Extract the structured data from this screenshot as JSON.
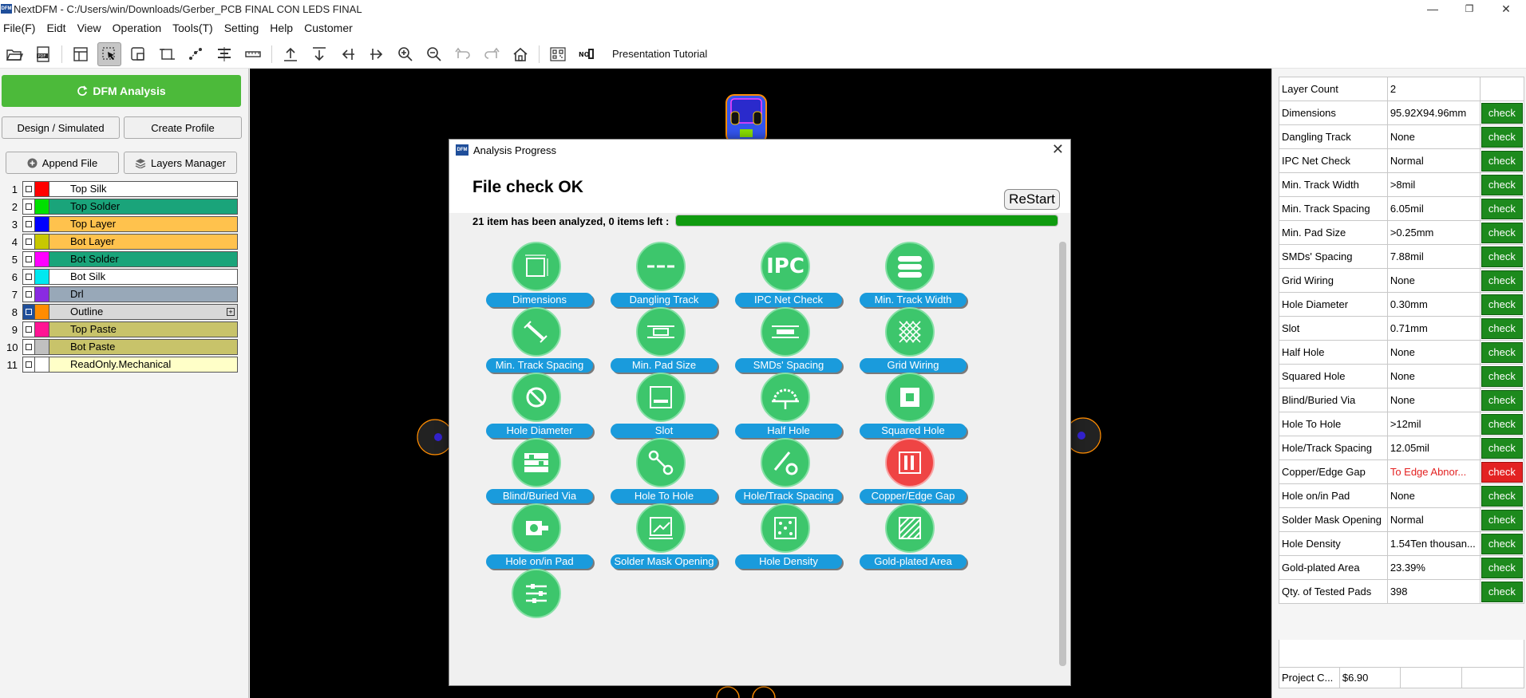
{
  "window": {
    "title": "NextDFM - C:/Users/win/Downloads/Gerber_PCB FINAL CON LEDS FINAL",
    "logo_text": "DFM",
    "minimize": "—",
    "maximize": "❐",
    "close": "✕"
  },
  "menu": [
    "File(F)",
    "Eidt",
    "View",
    "Operation",
    "Tools(T)",
    "Setting",
    "Help",
    "Customer"
  ],
  "toolbar": {
    "tutorial_label": "Presentation Tutorial",
    "icons": [
      "open-folder-icon",
      "pdf-icon",
      "layout-icon",
      "select-pointer-icon",
      "zoom-window-icon",
      "rotate-icon",
      "network-icon",
      "align-icon",
      "ruler-icon",
      "export-icon",
      "import-icon",
      "align-left-icon",
      "align-right-icon",
      "zoom-in-icon",
      "zoom-out-icon",
      "undo-icon",
      "redo-icon",
      "home-icon",
      "qr-icon",
      "no-icon"
    ],
    "active_icon": "select-pointer-icon"
  },
  "left_panel": {
    "dfm_button": "DFM Analysis",
    "design_button": "Design / Simulated",
    "create_profile_button": "Create Profile",
    "append_file_button": "Append File",
    "layers_manager_button": "Layers Manager",
    "layers": [
      {
        "num": "1",
        "name": "Top Silk",
        "swatch": "#ff0000",
        "bg": "#ffffff"
      },
      {
        "num": "2",
        "name": "Top Solder",
        "swatch": "#00e000",
        "bg": "#1aa47a"
      },
      {
        "num": "3",
        "name": "Top Layer",
        "swatch": "#0000ff",
        "bg": "#ffc24d"
      },
      {
        "num": "4",
        "name": "Bot Layer",
        "swatch": "#c8c800",
        "bg": "#ffc24d"
      },
      {
        "num": "5",
        "name": "Bot Solder",
        "swatch": "#ff00ff",
        "bg": "#1aa47a"
      },
      {
        "num": "6",
        "name": "Bot Silk",
        "swatch": "#00e8f0",
        "bg": "#ffffff"
      },
      {
        "num": "7",
        "name": "Drl",
        "swatch": "#8a2be2",
        "bg": "#98a8b8"
      },
      {
        "num": "8",
        "name": "Outline",
        "swatch": "#ff8c00",
        "bg": "#d8d8d8",
        "checked": true
      },
      {
        "num": "9",
        "name": "Top Paste",
        "swatch": "#ff1493",
        "bg": "#c8c36a"
      },
      {
        "num": "10",
        "name": "Bot Paste",
        "swatch": "#c0c0c0",
        "bg": "#c8c36a"
      },
      {
        "num": "11",
        "name": "ReadOnly.Mechanical",
        "swatch": "#ffffff",
        "bg": "#ffffc8"
      }
    ]
  },
  "dialog": {
    "title": "Analysis Progress",
    "status": "File check OK",
    "restart": "ReStart",
    "progress_text": "21 item has been analyzed, 0 items left :",
    "progress": 1.0,
    "items": [
      {
        "label": "Dimensions",
        "icon": "dimensions-icon"
      },
      {
        "label": "Dangling Track",
        "icon": "dangling-track-icon"
      },
      {
        "label": "IPC Net Check",
        "icon": "ipc-icon",
        "icon_text": "IPC"
      },
      {
        "label": "Min. Track Width",
        "icon": "track-width-icon"
      },
      {
        "label": "Min. Track Spacing",
        "icon": "track-spacing-icon"
      },
      {
        "label": "Min. Pad Size",
        "icon": "pad-size-icon"
      },
      {
        "label": "SMDs' Spacing",
        "icon": "smd-spacing-icon"
      },
      {
        "label": "Grid Wiring",
        "icon": "grid-wiring-icon"
      },
      {
        "label": "Hole Diameter",
        "icon": "hole-diameter-icon"
      },
      {
        "label": "Slot",
        "icon": "slot-icon"
      },
      {
        "label": "Half Hole",
        "icon": "half-hole-icon"
      },
      {
        "label": "Squared Hole",
        "icon": "squared-hole-icon"
      },
      {
        "label": "Blind/Buried Via",
        "icon": "blind-via-icon"
      },
      {
        "label": "Hole To Hole",
        "icon": "hole-to-hole-icon"
      },
      {
        "label": "Hole/Track Spacing",
        "icon": "hole-track-icon"
      },
      {
        "label": "Copper/Edge Gap",
        "icon": "copper-edge-icon",
        "status": "error"
      },
      {
        "label": "Hole on/in Pad",
        "icon": "hole-in-pad-icon"
      },
      {
        "label": "Solder Mask Opening",
        "icon": "solder-mask-icon"
      },
      {
        "label": "Hole Density",
        "icon": "hole-density-icon"
      },
      {
        "label": "Gold-plated Area",
        "icon": "gold-area-icon"
      },
      {
        "label": "",
        "icon": "tested-pads-icon"
      }
    ]
  },
  "stats": [
    {
      "name": "Layer Count",
      "value": "2",
      "check": ""
    },
    {
      "name": "Dimensions",
      "value": "95.92X94.96mm",
      "check": "check"
    },
    {
      "name": "Dangling Track",
      "value": "None",
      "check": "check"
    },
    {
      "name": "IPC Net Check",
      "value": "Normal",
      "check": "check"
    },
    {
      "name": "Min. Track Width",
      "value": ">8mil",
      "check": "check"
    },
    {
      "name": "Min. Track Spacing",
      "value": "6.05mil",
      "check": "check"
    },
    {
      "name": "Min. Pad Size",
      "value": ">0.25mm",
      "check": "check"
    },
    {
      "name": "SMDs' Spacing",
      "value": "7.88mil",
      "check": "check"
    },
    {
      "name": "Grid Wiring",
      "value": "None",
      "check": "check"
    },
    {
      "name": "Hole Diameter",
      "value": "0.30mm",
      "check": "check"
    },
    {
      "name": "Slot",
      "value": "0.71mm",
      "check": "check"
    },
    {
      "name": "Half Hole",
      "value": "None",
      "check": "check"
    },
    {
      "name": "Squared Hole",
      "value": "None",
      "check": "check"
    },
    {
      "name": "Blind/Buried Via",
      "value": "None",
      "check": "check"
    },
    {
      "name": "Hole To Hole",
      "value": ">12mil",
      "check": "check"
    },
    {
      "name": "Hole/Track Spacing",
      "value": "12.05mil",
      "check": "check"
    },
    {
      "name": "Copper/Edge Gap",
      "value": "To Edge Abnor...",
      "check": "check",
      "error": true
    },
    {
      "name": "Hole on/in Pad",
      "value": "None",
      "check": "check"
    },
    {
      "name": "Solder Mask Opening",
      "value": "Normal",
      "check": "check"
    },
    {
      "name": "Hole Density",
      "value": "1.54Ten thousan...",
      "check": "check"
    },
    {
      "name": "Gold-plated Area",
      "value": "23.39%",
      "check": "check"
    },
    {
      "name": "Qty. of Tested Pads",
      "value": "398",
      "check": "check"
    }
  ],
  "cost": {
    "label": "Project C...",
    "value": "$6.90"
  },
  "colors": {
    "accent_green": "#4cba3a",
    "check_green": "#1d8a1d",
    "error_red": "#e32222",
    "item_green": "#3dc66c",
    "label_blue": "#1a9bdc",
    "progress_green": "#0f9b0f"
  }
}
